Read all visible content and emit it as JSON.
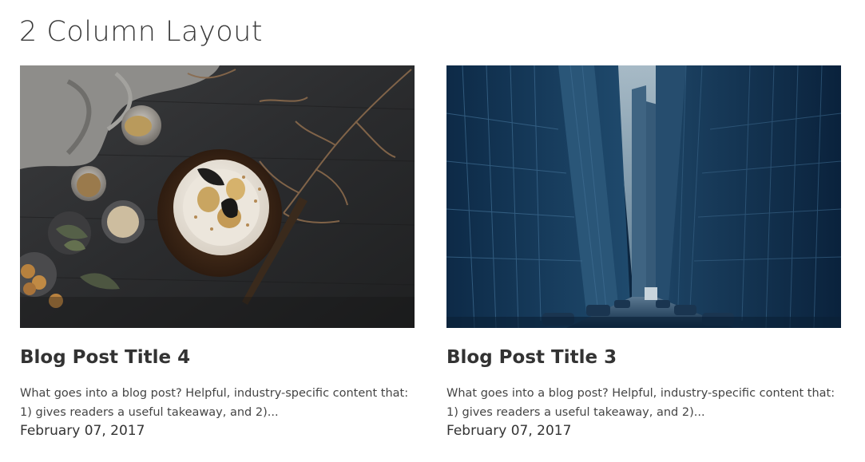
{
  "section": {
    "title": "2 Column Layout"
  },
  "posts": [
    {
      "title": "Blog Post Title 4",
      "excerpt_line1": "What goes into a blog post? Helpful, industry-specific content that:",
      "excerpt_line2": "1) gives readers a useful takeaway, and 2)...",
      "date": "February 07, 2017"
    },
    {
      "title": "Blog Post Title 3",
      "excerpt_line1": "What goes into a blog post? Helpful, industry-specific content that:",
      "excerpt_line2": "1) gives readers a useful takeaway, and 2)...",
      "date": "February 07, 2017"
    }
  ],
  "colors": {
    "text": "#333333",
    "background": "#ffffff"
  }
}
